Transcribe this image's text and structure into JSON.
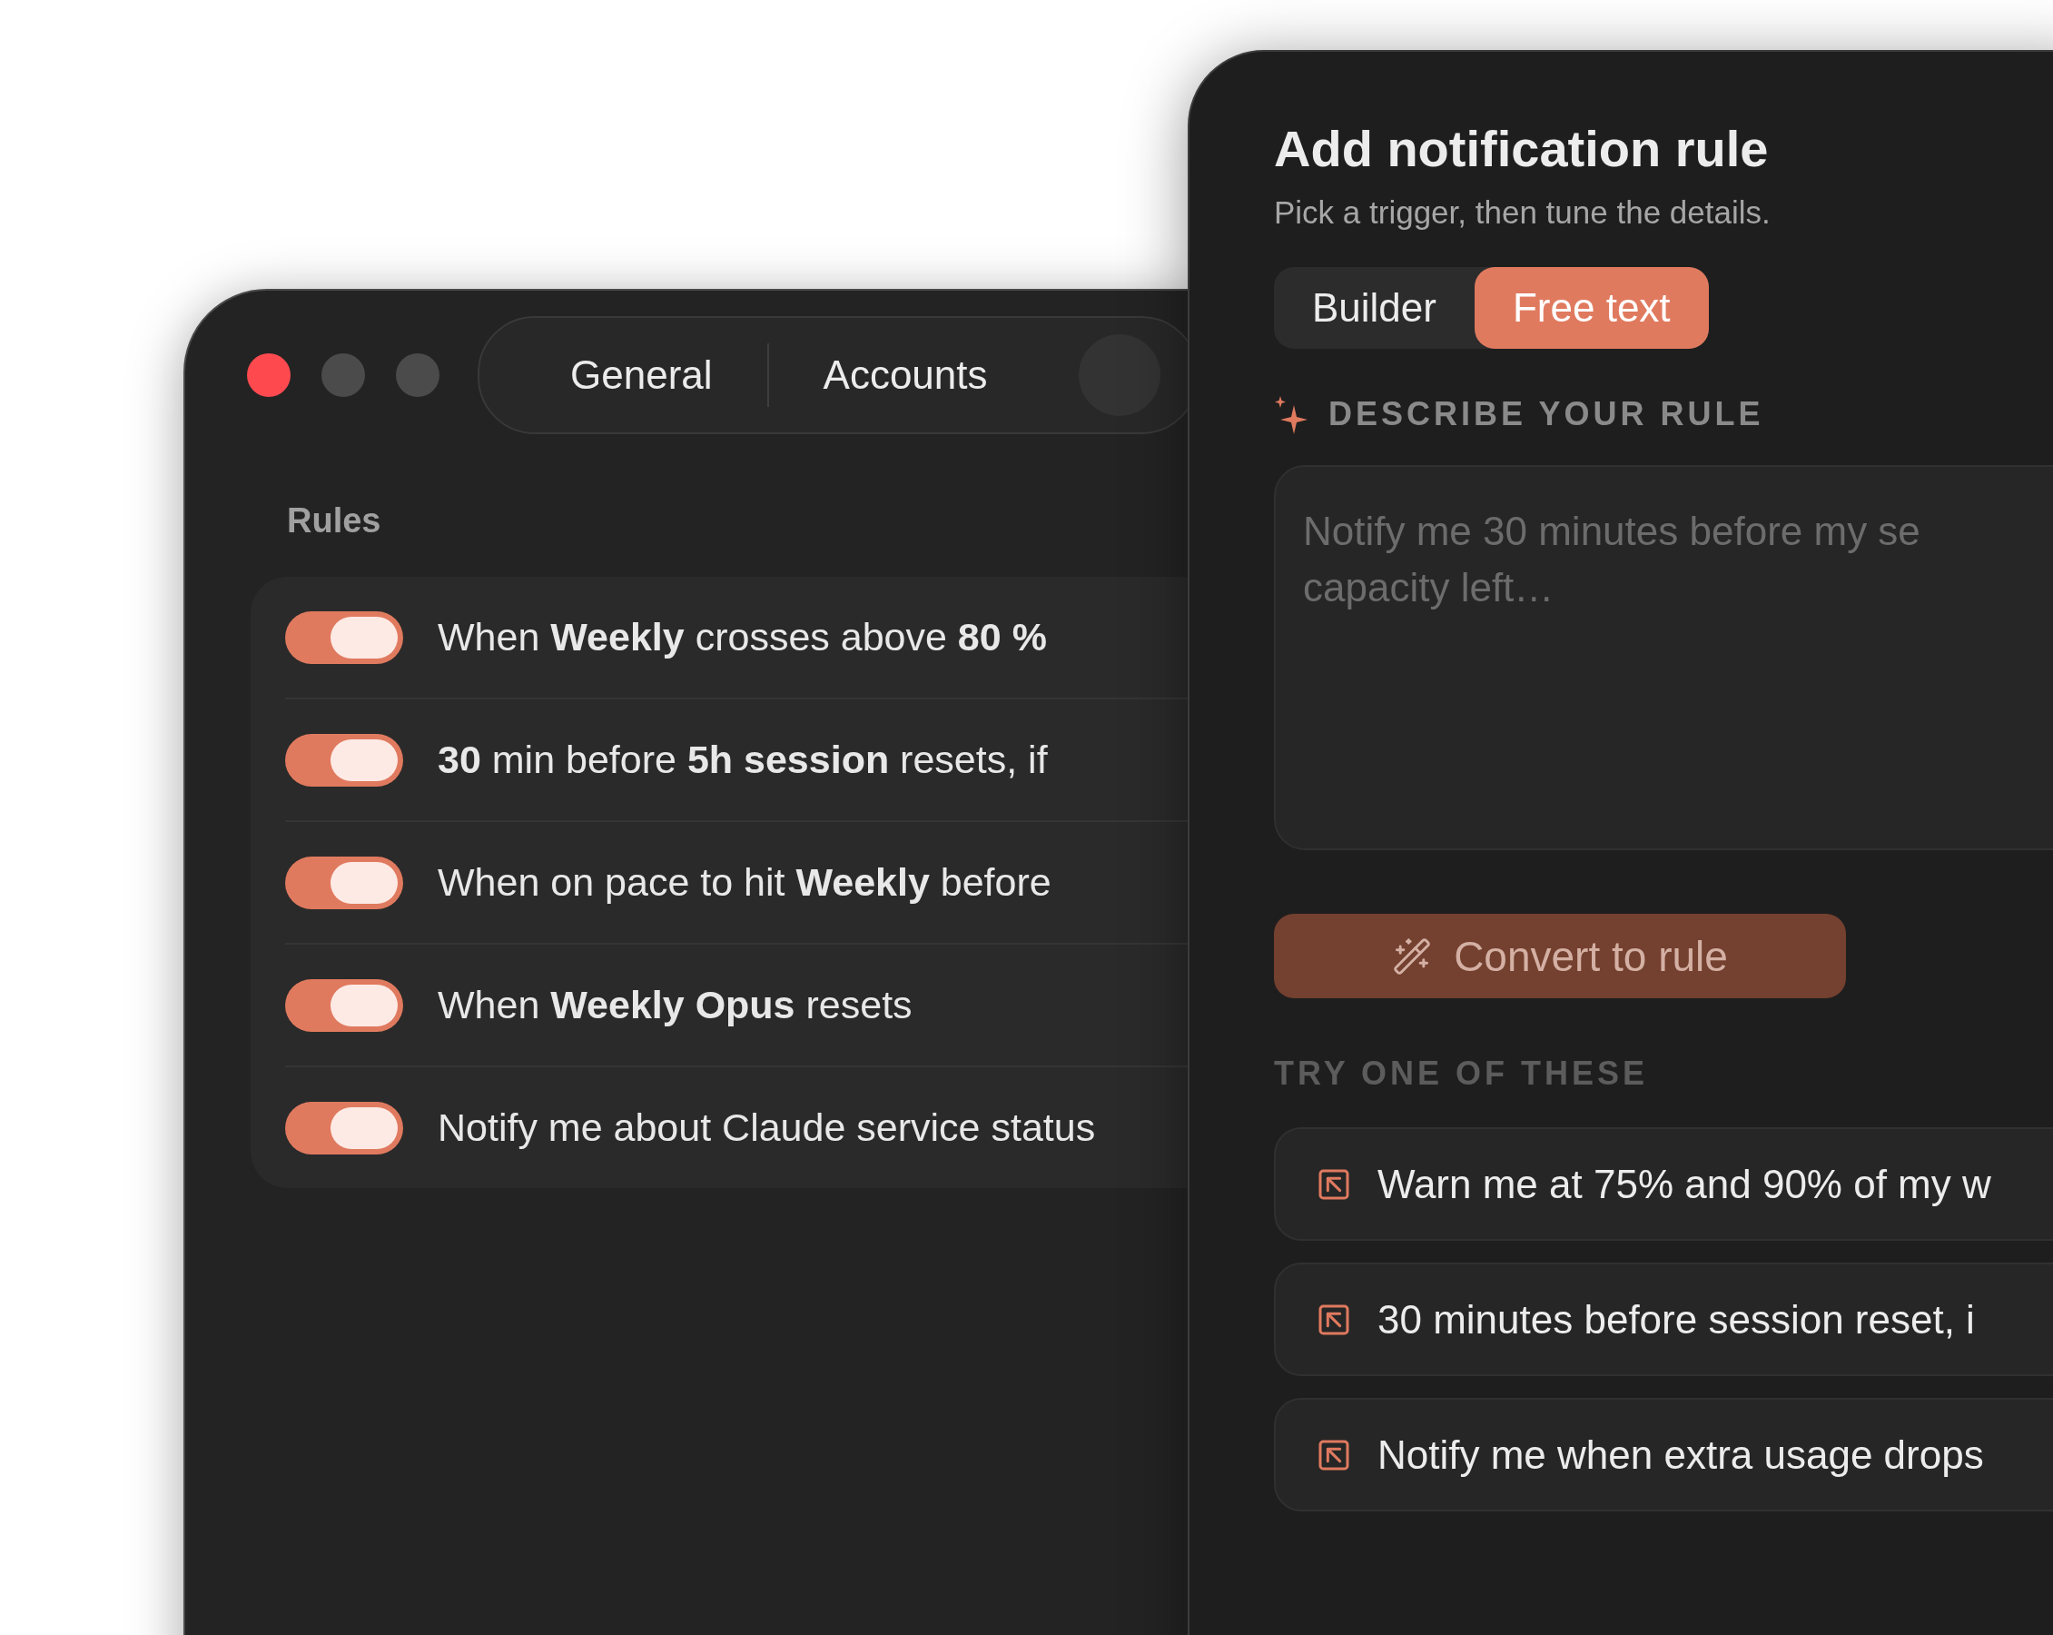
{
  "settings_window": {
    "tabs": [
      {
        "label": "General",
        "selected": false
      },
      {
        "label": "Accounts",
        "selected": false
      }
    ],
    "rules_label": "Rules",
    "rules": [
      {
        "text": "When **Weekly** crosses above **80 %**",
        "on": true
      },
      {
        "text": "**30** min before **5h session** resets, if",
        "on": true
      },
      {
        "text": "When on pace to hit **Weekly** before",
        "on": true
      },
      {
        "text": "When **Weekly Opus** resets",
        "on": true
      },
      {
        "text": "Notify me about Claude service status",
        "on": true
      }
    ]
  },
  "rule_dialog": {
    "title": "Add notification rule",
    "subtitle": "Pick a trigger, then tune the details.",
    "modes": [
      {
        "label": "Builder",
        "selected": false
      },
      {
        "label": "Free text",
        "selected": true
      }
    ],
    "describe_label": "DESCRIBE YOUR RULE",
    "description": {
      "placeholder": "Notify me 30 minutes before my se\ncapacity left…"
    },
    "convert_button": {
      "label": "Convert to rule",
      "disabled": true
    },
    "suggestions_label": "TRY ONE OF THESE",
    "suggestions": [
      "Warn me at 75% and 90% of my w",
      "30 minutes before session reset, i",
      "Notify me when extra usage drops"
    ]
  }
}
